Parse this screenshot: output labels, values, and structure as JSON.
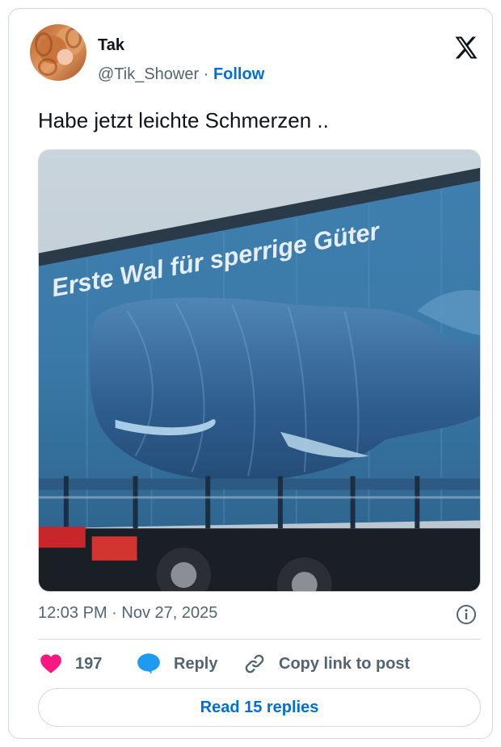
{
  "author": {
    "name": "Tak",
    "handle": "@Tik_Shower",
    "separator": " · ",
    "follow_label": "Follow"
  },
  "tweet": {
    "text": "Habe jetzt leichte Schmerzen .."
  },
  "media": {
    "truck_slogan": "Erste Wal für sperrige Güter"
  },
  "meta": {
    "timestamp": "12:03 PM · Nov 27, 2025"
  },
  "actions": {
    "likes_count": "197",
    "reply_label": "Reply",
    "copy_link_label": "Copy link to post"
  },
  "replies_button": {
    "label": "Read 15 replies"
  },
  "colors": {
    "accent": "#006fd6",
    "like": "#f91880",
    "reply_icon": "#1d9bf0",
    "muted": "#536471"
  }
}
